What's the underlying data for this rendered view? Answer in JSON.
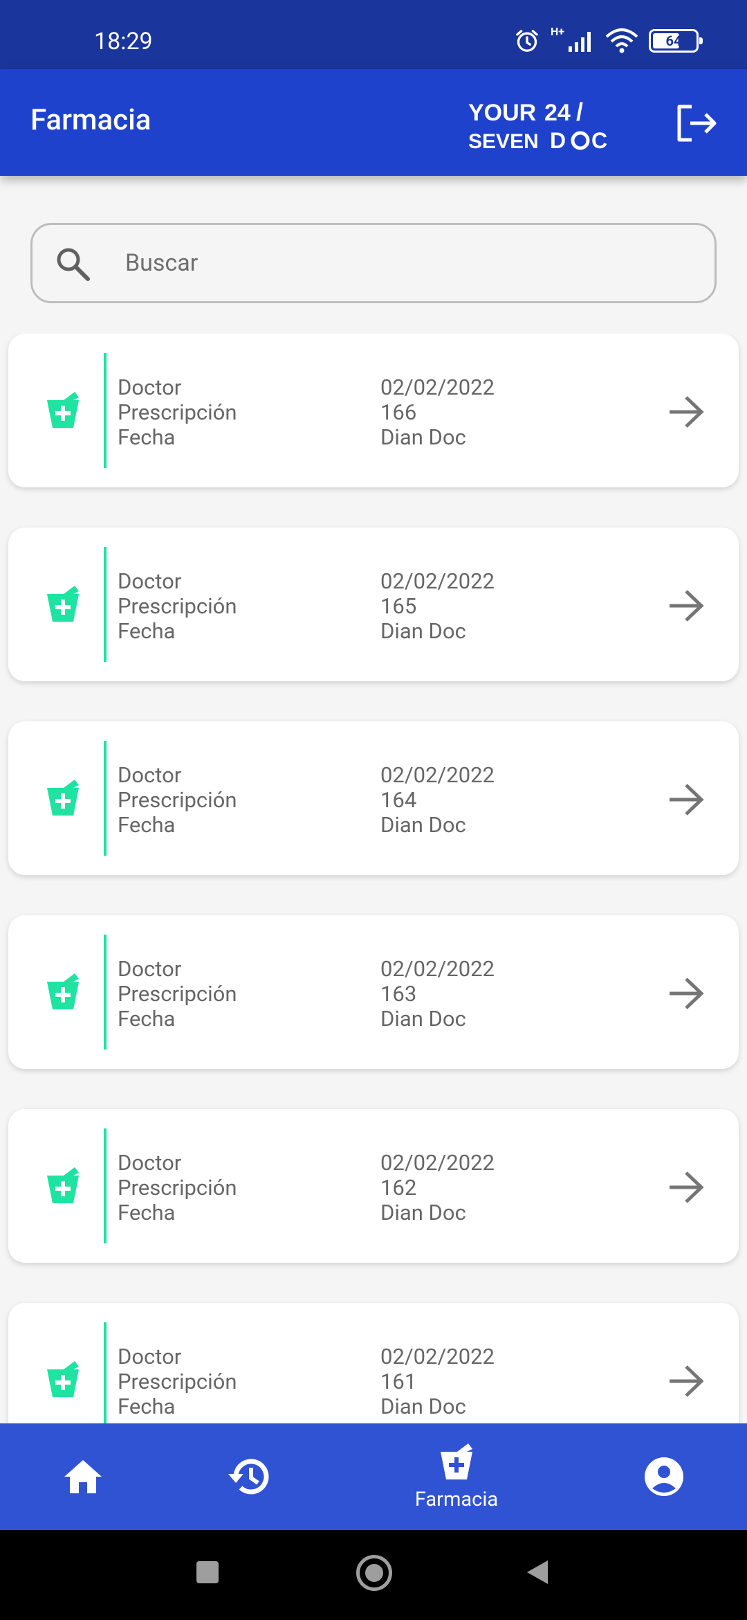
{
  "status_bar": {
    "time": "18:29",
    "network_label": "H+",
    "battery": 64
  },
  "app_bar": {
    "title": "Farmacia",
    "logo_text": "YOUR 24 / SEVEN DOC",
    "logout_icon": "logout-icon"
  },
  "search": {
    "placeholder": "Buscar",
    "value": ""
  },
  "prescriptions": {
    "labels": [
      "Doctor",
      "Prescripción",
      "Fecha"
    ],
    "items": [
      {
        "date": "02/02/2022",
        "number": "166",
        "doctor": "Dian Doc"
      },
      {
        "date": "02/02/2022",
        "number": "165",
        "doctor": "Dian Doc"
      },
      {
        "date": "02/02/2022",
        "number": "164",
        "doctor": "Dian Doc"
      },
      {
        "date": "02/02/2022",
        "number": "163",
        "doctor": "Dian Doc"
      },
      {
        "date": "02/02/2022",
        "number": "162",
        "doctor": "Dian Doc"
      },
      {
        "date": "02/02/2022",
        "number": "161",
        "doctor": "Dian Doc"
      }
    ]
  },
  "bottom_nav": {
    "items": [
      {
        "icon": "home-icon",
        "label": ""
      },
      {
        "icon": "history-icon",
        "label": ""
      },
      {
        "icon": "pharmacy-icon",
        "label": "Farmacia",
        "active": true
      },
      {
        "icon": "profile-icon",
        "label": ""
      }
    ]
  },
  "colors": {
    "status_bar": "#1a359c",
    "app_bar": "#1f42cc",
    "bottom_nav": "#3053d4",
    "accent_green": "#1fe3a0",
    "text_gray": "#666666"
  }
}
